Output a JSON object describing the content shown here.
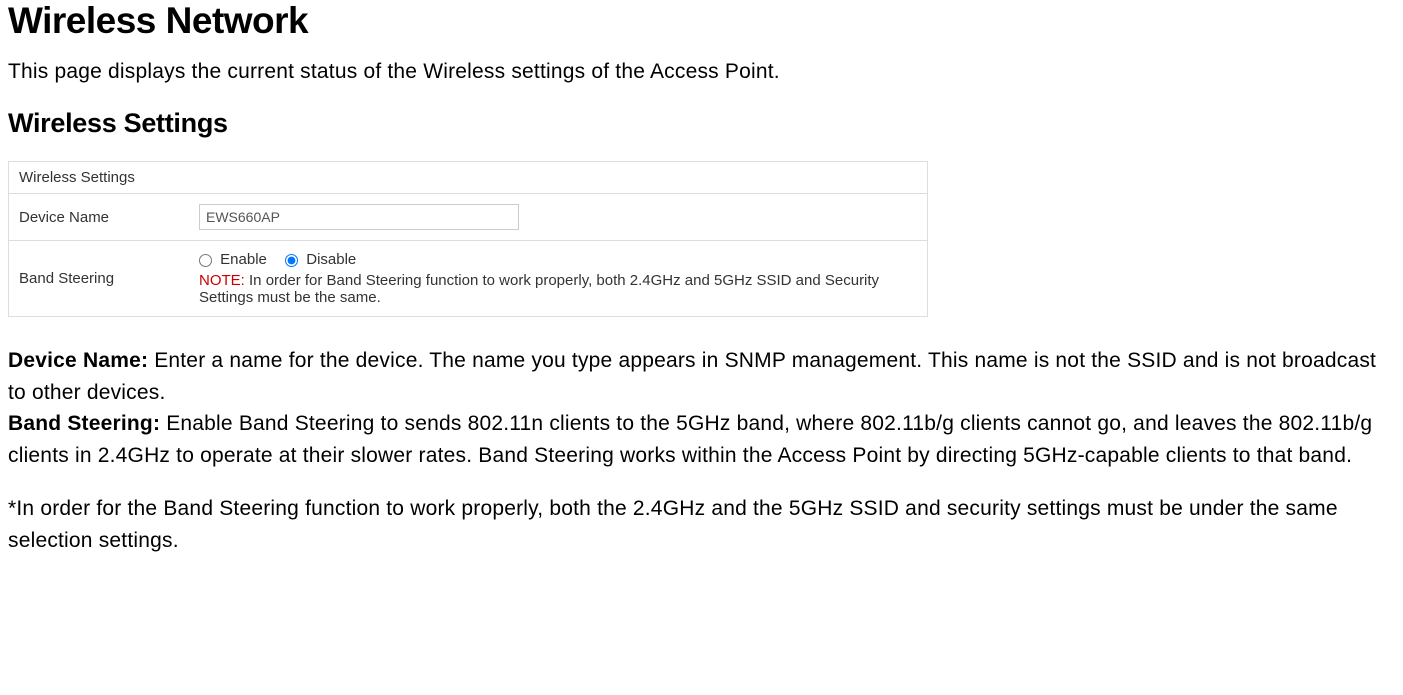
{
  "page": {
    "title": "Wireless Network",
    "intro": "This page displays the current status of the Wireless settings of the Access Point.",
    "section_title": "Wireless Settings"
  },
  "settings_box": {
    "header": "Wireless Settings",
    "device_name_label": "Device Name",
    "device_name_value": "EWS660AP",
    "band_steering_label": "Band Steering",
    "enable_label": "Enable",
    "disable_label": "Disable",
    "note_prefix": "NOTE:",
    "note_text": "In order for Band Steering function to work properly, both 2.4GHz and 5GHz SSID and Security Settings must be the same."
  },
  "desc": {
    "device_name_label": "Device Name:",
    "device_name_text": " Enter a name for the device. The name you type appears in SNMP management. This name is not the SSID and is not broadcast to other devices.",
    "band_steering_label": "Band Steering:",
    "band_steering_text": " Enable Band Steering to sends 802.11n clients to the 5GHz band, where 802.11b/g clients cannot go, and leaves the 802.11b/g clients in 2.4GHz to operate at their slower rates. Band Steering works within the Access Point by directing 5GHz-capable clients to that band.",
    "footnote": "*In order for the Band Steering function to work properly, both the 2.4GHz and the 5GHz SSID and security settings must be under the same selection settings."
  }
}
